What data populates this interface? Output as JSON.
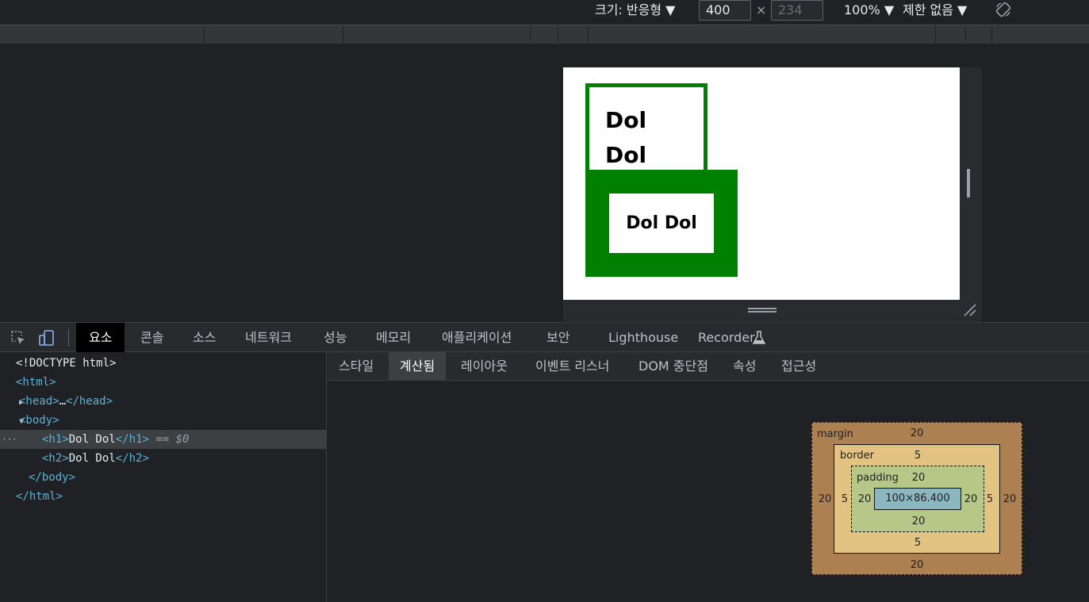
{
  "device_toolbar": {
    "size_label": "크기: 반응형 ▼",
    "width_value": "400",
    "times": "×",
    "height_placeholder": "234",
    "zoom": "100% ▼",
    "throttle": "제한 없음 ▼",
    "rotate_icon": "rotate-icon"
  },
  "preview": {
    "h1_text": "Dol Dol",
    "h2_text": "Dol Dol",
    "h1_border_color": "#008000",
    "h2_border_color": "#008000"
  },
  "devtools": {
    "tabs": [
      {
        "label": "요소",
        "active": true
      },
      {
        "label": "콘솔"
      },
      {
        "label": "소스"
      },
      {
        "label": "네트워크"
      },
      {
        "label": "성능"
      },
      {
        "label": "메모리"
      },
      {
        "label": "애플리케이션"
      },
      {
        "label": "보안"
      },
      {
        "label": "Lighthouse"
      },
      {
        "label": "Recorder"
      }
    ],
    "icons": [
      "inspect-icon",
      "device-toggle-icon",
      "flask-icon"
    ]
  },
  "elements": {
    "doctype": "<!DOCTYPE html>",
    "html_open": "<html>",
    "head_open": "<head>",
    "head_ellipsis": "…",
    "head_close": "</head>",
    "body_open": "<body>",
    "h1_open": "<h1>",
    "h1_text": "Dol Dol",
    "h1_close": "</h1>",
    "selected_marker": "== $0",
    "h2_open": "<h2>",
    "h2_text": "Dol Dol",
    "h2_close": "</h2>",
    "body_close": "</body>",
    "html_close": "</html>",
    "row_dots": "···"
  },
  "sub_tabs": [
    {
      "label": "스타일"
    },
    {
      "label": "계산됨",
      "active": true
    },
    {
      "label": "레이아웃"
    },
    {
      "label": "이벤트 리스너"
    },
    {
      "label": "DOM 중단점"
    },
    {
      "label": "속성"
    },
    {
      "label": "접근성"
    }
  ],
  "box_model": {
    "margin_label": "margin",
    "border_label": "border",
    "padding_label": "padding",
    "margin": {
      "top": "20",
      "right": "20",
      "bottom": "20",
      "left": "20"
    },
    "border": {
      "top": "5",
      "right": "5",
      "bottom": "5",
      "left": "5"
    },
    "padding": {
      "top": "20",
      "right": "20",
      "bottom": "20",
      "left": "20"
    },
    "content": "100×86.400",
    "colors": {
      "margin": "#ad8052",
      "border": "#e3c381",
      "padding": "#b7c787",
      "content": "#8cb6c0"
    }
  }
}
